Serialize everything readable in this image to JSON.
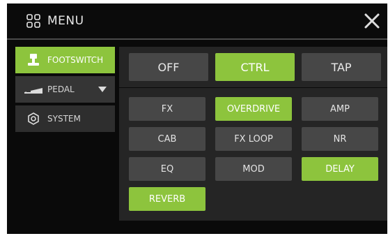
{
  "header": {
    "menu_label": "MENU",
    "menu_icon": "grid-icon",
    "close_icon": "close-icon"
  },
  "sidebar": {
    "items": [
      {
        "label": "FOOTSWITCH",
        "icon": "footswitch-icon",
        "active": true
      },
      {
        "label": "PEDAL",
        "icon": "pedal-icon",
        "active": false,
        "dropdown": true
      },
      {
        "label": "SYSTEM",
        "icon": "system-icon",
        "active": false
      }
    ]
  },
  "modes": [
    {
      "label": "OFF",
      "active": false
    },
    {
      "label": "CTRL",
      "active": true
    },
    {
      "label": "TAP",
      "active": false
    }
  ],
  "effects": [
    {
      "label": "FX",
      "active": false
    },
    {
      "label": "OVERDRIVE",
      "active": true
    },
    {
      "label": "AMP",
      "active": false
    },
    {
      "label": "CAB",
      "active": false
    },
    {
      "label": "FX LOOP",
      "active": false
    },
    {
      "label": "NR",
      "active": false
    },
    {
      "label": "EQ",
      "active": false
    },
    {
      "label": "MOD",
      "active": false
    },
    {
      "label": "DELAY",
      "active": true
    },
    {
      "label": "REVERB",
      "active": true
    }
  ],
  "colors": {
    "accent": "#8dc43d",
    "button": "#474747",
    "panel": "#252525",
    "background": "#0a0a0a"
  }
}
